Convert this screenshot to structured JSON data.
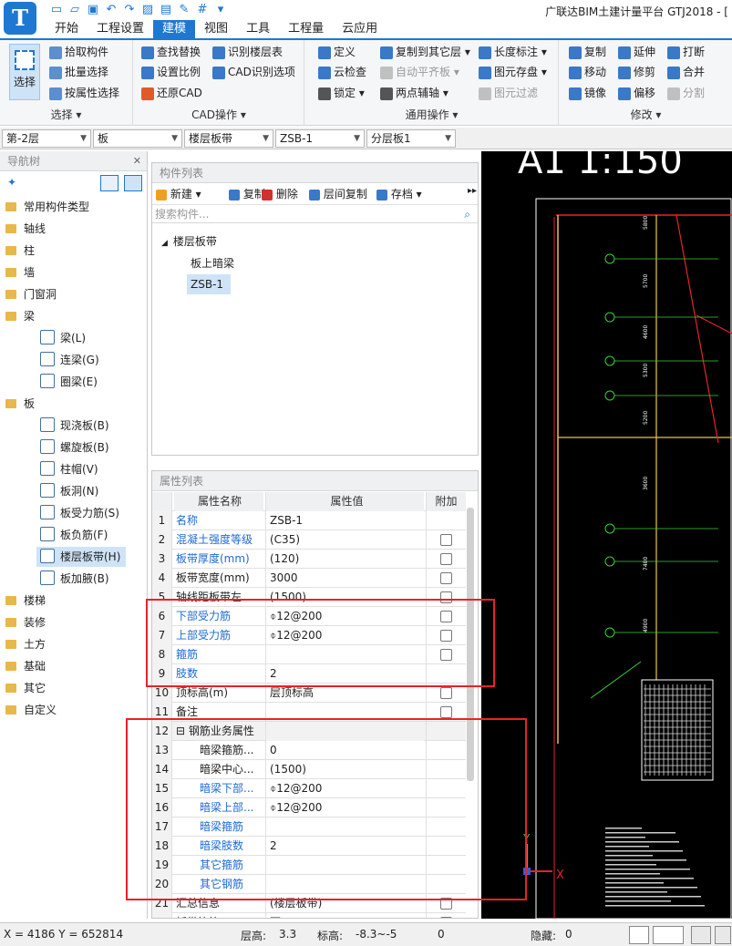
{
  "titlebar": {
    "logo": "T",
    "qat_icons": [
      "new-file-icon",
      "open-folder-icon",
      "save-icon",
      "undo-icon",
      "redo-icon",
      "image-icon",
      "layers-icon",
      "pen-icon",
      "grid-icon",
      "more-icon"
    ],
    "app_title": "广联达BIM土建计量平台 GTJ2018 - ["
  },
  "tabs": [
    "开始",
    "工程设置",
    "建模",
    "视图",
    "工具",
    "工程量",
    "云应用"
  ],
  "active_tab": "建模",
  "ribbon": {
    "select": {
      "label": "选择",
      "group": "选择",
      "buttons": [
        "拾取构件",
        "批量选择",
        "按属性选择"
      ]
    },
    "cad": {
      "group": "CAD操作",
      "buttons": [
        "查找替换",
        "识别楼层表",
        "设置比例",
        "CAD识别选项",
        "还原CAD"
      ]
    },
    "common": {
      "group": "通用操作",
      "buttons": [
        "定义",
        "复制到其它层",
        "长度标注",
        "云检查",
        "自动平齐板",
        "图元存盘",
        "锁定",
        "两点辅轴",
        "图元过滤"
      ]
    },
    "modify": {
      "group": "修改",
      "buttons": [
        "复制",
        "延伸",
        "打断",
        "移动",
        "修剪",
        "合并",
        "镜像",
        "偏移",
        "分割"
      ]
    }
  },
  "selectors": [
    "第-2层",
    "板",
    "楼层板带",
    "ZSB-1",
    "分层板1"
  ],
  "nav": {
    "title": "导航树",
    "items": [
      {
        "label": "常用构件类型",
        "type": "folder"
      },
      {
        "label": "轴线",
        "type": "folder"
      },
      {
        "label": "柱",
        "type": "folder"
      },
      {
        "label": "墙",
        "type": "folder"
      },
      {
        "label": "门窗洞",
        "type": "folder"
      },
      {
        "label": "梁",
        "type": "folder"
      },
      {
        "label": "梁(L)",
        "type": "sub"
      },
      {
        "label": "连梁(G)",
        "type": "sub"
      },
      {
        "label": "圈梁(E)",
        "type": "sub"
      },
      {
        "label": "板",
        "type": "folder"
      },
      {
        "label": "现浇板(B)",
        "type": "sub"
      },
      {
        "label": "螺旋板(B)",
        "type": "sub"
      },
      {
        "label": "柱帽(V)",
        "type": "sub"
      },
      {
        "label": "板洞(N)",
        "type": "sub"
      },
      {
        "label": "板受力筋(S)",
        "type": "sub"
      },
      {
        "label": "板负筋(F)",
        "type": "sub"
      },
      {
        "label": "楼层板带(H)",
        "type": "sub",
        "selected": true
      },
      {
        "label": "板加腋(B)",
        "type": "sub"
      },
      {
        "label": "楼梯",
        "type": "folder"
      },
      {
        "label": "装修",
        "type": "folder"
      },
      {
        "label": "土方",
        "type": "folder"
      },
      {
        "label": "基础",
        "type": "folder"
      },
      {
        "label": "其它",
        "type": "folder"
      },
      {
        "label": "自定义",
        "type": "folder"
      }
    ]
  },
  "component_list": {
    "title": "构件列表",
    "toolbar": [
      "新建",
      "复制",
      "删除",
      "层间复制",
      "存档"
    ],
    "search_placeholder": "搜索构件...",
    "tree": {
      "root": "楼层板带",
      "children": [
        "板上暗梁",
        "ZSB-1"
      ],
      "selected": "ZSB-1"
    }
  },
  "properties": {
    "title": "属性列表",
    "headers": [
      "属性名称",
      "属性值",
      "附加"
    ],
    "rows": [
      {
        "n": "1",
        "name": "名称",
        "value": "ZSB-1",
        "blue": true,
        "check": false
      },
      {
        "n": "2",
        "name": "混凝土强度等级",
        "value": "(C35)",
        "blue": true,
        "check": true
      },
      {
        "n": "3",
        "name": "板带厚度(mm)",
        "value": "(120)",
        "blue": true,
        "check": true
      },
      {
        "n": "4",
        "name": "板带宽度(mm)",
        "value": "3000",
        "blue": false,
        "check": true
      },
      {
        "n": "5",
        "name": "轴线距板带左",
        "value": "(1500)",
        "blue": false,
        "check": true
      },
      {
        "n": "6",
        "name": "下部受力筋",
        "value": "⌽12@200",
        "blue": true,
        "check": true
      },
      {
        "n": "7",
        "name": "上部受力筋",
        "value": "⌽12@200",
        "blue": true,
        "check": true
      },
      {
        "n": "8",
        "name": "箍筋",
        "value": "",
        "blue": true,
        "check": true
      },
      {
        "n": "9",
        "name": "肢数",
        "value": "2",
        "blue": true,
        "check": false
      },
      {
        "n": "10",
        "name": "顶标高(m)",
        "value": "层顶标高",
        "blue": false,
        "check": true
      },
      {
        "n": "11",
        "name": "备注",
        "value": "",
        "blue": false,
        "check": true
      },
      {
        "n": "12",
        "name": "钢筋业务属性",
        "value": "",
        "blue": false,
        "check": false,
        "group": true
      },
      {
        "n": "13",
        "name": "暗梁箍筋...",
        "value": "0",
        "blue": false,
        "check": false,
        "indent": true
      },
      {
        "n": "14",
        "name": "暗梁中心...",
        "value": "(1500)",
        "blue": false,
        "check": false,
        "indent": true
      },
      {
        "n": "15",
        "name": "暗梁下部...",
        "value": "⌽12@200",
        "blue": true,
        "check": false,
        "indent": true
      },
      {
        "n": "16",
        "name": "暗梁上部...",
        "value": "⌽12@200",
        "blue": true,
        "check": false,
        "indent": true
      },
      {
        "n": "17",
        "name": "暗梁箍筋",
        "value": "",
        "blue": true,
        "check": false,
        "indent": true
      },
      {
        "n": "18",
        "name": "暗梁肢数",
        "value": "2",
        "blue": true,
        "check": false,
        "indent": true
      },
      {
        "n": "19",
        "name": "其它箍筋",
        "value": "",
        "blue": true,
        "check": false,
        "indent": true
      },
      {
        "n": "20",
        "name": "其它钢筋",
        "value": "",
        "blue": true,
        "check": false,
        "indent": true
      },
      {
        "n": "21",
        "name": "汇总信息",
        "value": "(楼层板带)",
        "blue": false,
        "check": true
      },
      {
        "n": "22",
        "name": "板带箍筋",
        "value": "否",
        "blue": false,
        "check": true
      }
    ]
  },
  "cad": {
    "title_text": "A1 1:150",
    "dims": [
      "5800",
      "5700",
      "4600",
      "5300",
      "5200",
      "3600",
      "7400",
      "4900"
    ],
    "axis_x": "X",
    "axis_y": "Y"
  },
  "status": {
    "coords": "X = 4186 Y = 652814",
    "floor_label": "层高:",
    "floor_value": "3.3",
    "elev_label": "标高:",
    "elev_value": "-8.3~-5",
    "count": "0",
    "hidden_label": "隐藏:",
    "hidden_value": "0"
  },
  "colors": {
    "accent": "#1e78d2",
    "highlight_box": "#e8222a"
  }
}
